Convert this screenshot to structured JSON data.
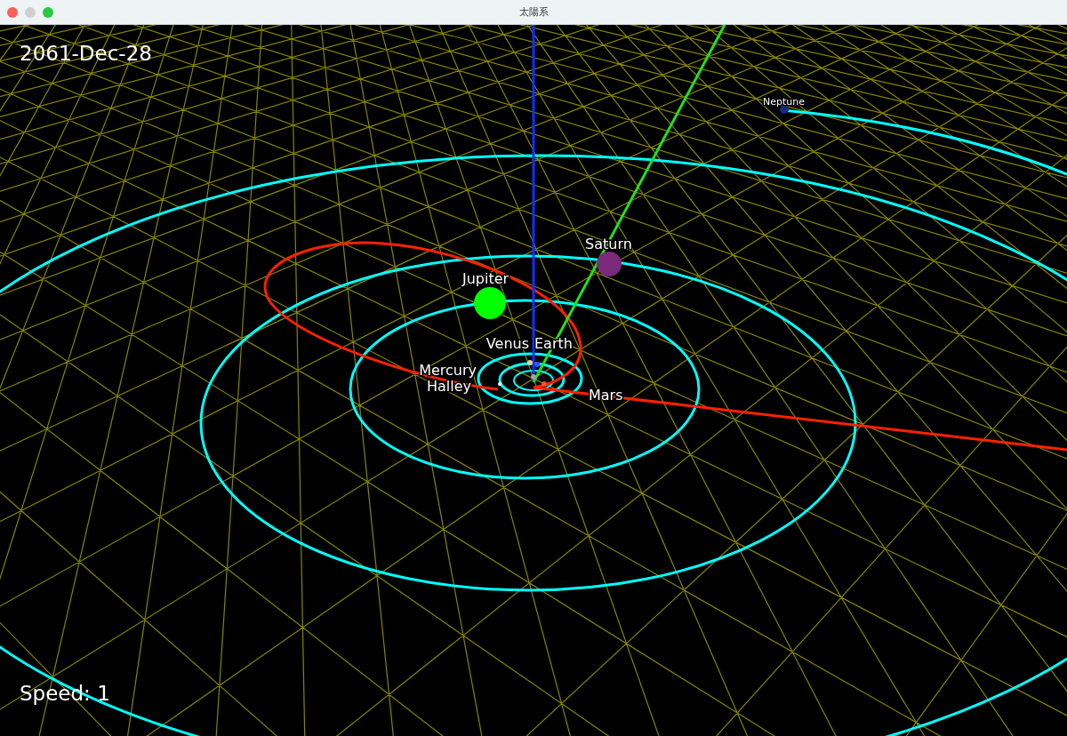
{
  "window": {
    "title": "太陽系"
  },
  "date": "2061-Dec-28",
  "speed": "Speed: 1",
  "bodies": [
    {
      "name": "Neptune",
      "color": "#1a2a80"
    },
    {
      "name": "Saturn",
      "color": "#7b2a7b"
    },
    {
      "name": "Jupiter",
      "color": "#00ff00"
    },
    {
      "name": "Venus",
      "color": "#e0d090"
    },
    {
      "name": "Earth",
      "color": "#3050ff"
    },
    {
      "name": "Mercury",
      "color": "#a0a0a0"
    },
    {
      "name": "Mars",
      "color": "#ff5020"
    },
    {
      "name": "Halley",
      "color": "#ffffff"
    }
  ]
}
